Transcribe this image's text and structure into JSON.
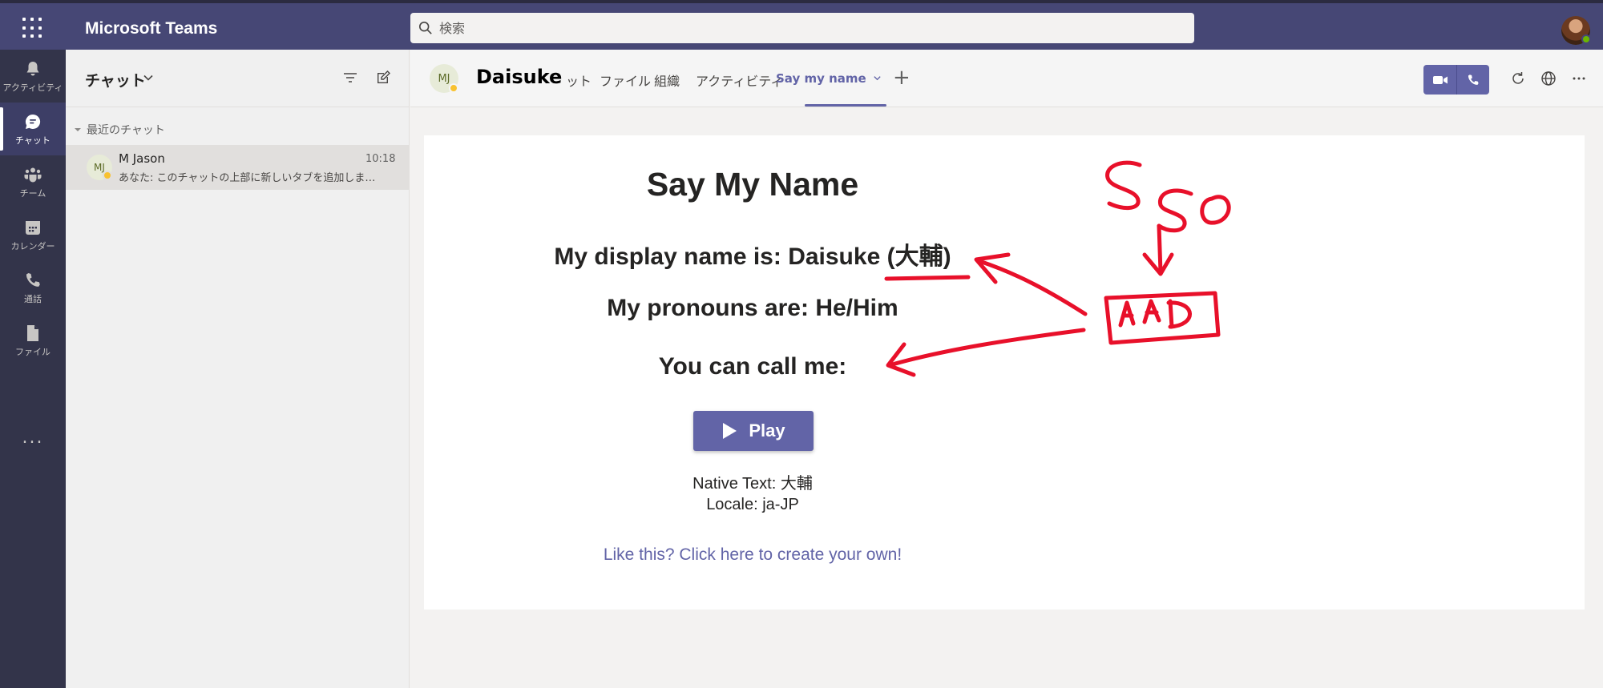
{
  "app": {
    "title": "Microsoft Teams"
  },
  "search": {
    "placeholder": "検索"
  },
  "rail": {
    "items": [
      {
        "label": "アクティビティ",
        "icon": "bell-icon"
      },
      {
        "label": "チャット",
        "icon": "chat-icon"
      },
      {
        "label": "チーム",
        "icon": "teams-icon"
      },
      {
        "label": "カレンダー",
        "icon": "calendar-icon"
      },
      {
        "label": "通話",
        "icon": "phone-icon"
      },
      {
        "label": "ファイル",
        "icon": "file-icon"
      }
    ],
    "more": "..."
  },
  "chat_panel": {
    "title": "チャット",
    "recent_label": "最近のチャット",
    "items": [
      {
        "initials": "MJ",
        "name": "M Jason",
        "time": "10:18",
        "preview": "あなた: このチャットの上部に新しいタブを追加しました。このタブを固定できます"
      }
    ]
  },
  "header": {
    "initials": "MJ",
    "name": "Daisuke",
    "tabs": [
      {
        "label": "ット"
      },
      {
        "label": "ファイル"
      },
      {
        "label": "組織"
      },
      {
        "label": "アクティビティ"
      },
      {
        "label": "Say my name"
      }
    ],
    "add_tab": "+",
    "accent_color": "#6264a7"
  },
  "content": {
    "title": "Say My Name",
    "display_name_line": "My display name is: Daisuke (大輔)",
    "pronouns_line": "My pronouns are: He/Him",
    "call_me_line": "You can call me:",
    "play_label": "Play",
    "native_text": "Native Text: 大輔",
    "locale": "Locale: ja-JP",
    "link": "Like this? Click here to create your own!"
  },
  "annotations": {
    "sso": "SSO",
    "aad": "AAD",
    "color": "#e8102a"
  }
}
